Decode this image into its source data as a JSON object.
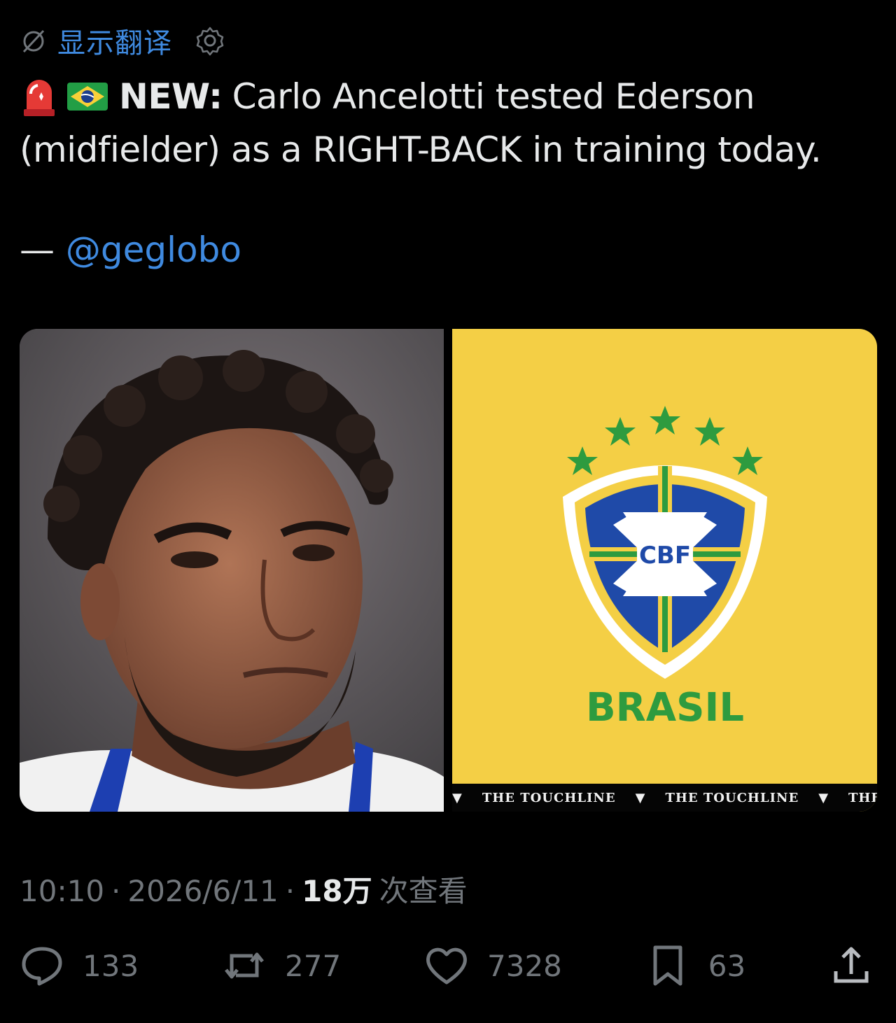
{
  "translate": {
    "label": "显示翻译"
  },
  "tweet": {
    "prefix_bold": "NEW:",
    "line1_rest": "Carlo Ancelotti tested Ederson",
    "line2": "(midfielder) as a RIGHT-BACK in training today.",
    "credit_dash": "—",
    "credit_handle": "@geglobo"
  },
  "media": {
    "logo_text_cbf": "CBF",
    "logo_text_brasil": "BRASIL",
    "strip_text": "THE TOUCHLINE"
  },
  "meta": {
    "time": "10:10",
    "sep": "·",
    "date": "2026/6/11",
    "views_count": "18万",
    "views_label": "次查看"
  },
  "actions": {
    "replies": "133",
    "reposts": "277",
    "likes": "7328",
    "bookmarks": "63"
  },
  "colors": {
    "background": "#000000",
    "link": "#3f8ae0",
    "muted": "#71767b",
    "brasil_yellow": "#f4cf45",
    "brasil_green": "#2e9b3f",
    "brasil_blue": "#1f4aa8"
  }
}
